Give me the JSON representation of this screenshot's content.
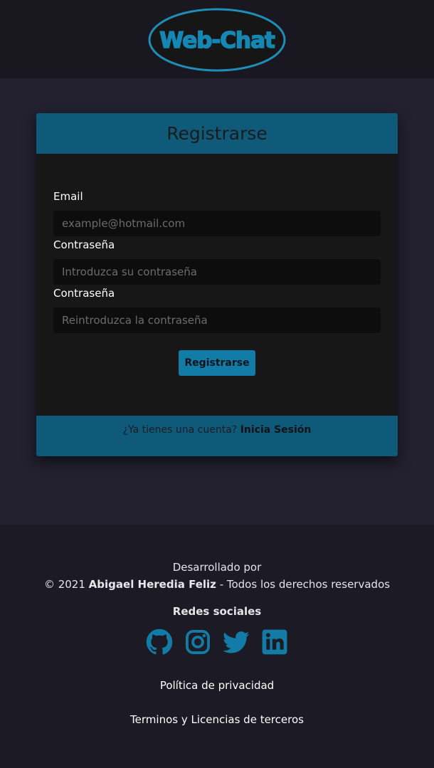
{
  "header": {
    "logo_text": "Web-Chat"
  },
  "colors": {
    "accent": "#0f5a79",
    "button": "#127ca6",
    "icon": "#127ca6",
    "background": "#23202f"
  },
  "register": {
    "title": "Registrarse",
    "email_label": "Email",
    "email_placeholder": "example@hotmail.com",
    "password_label": "Contraseña",
    "password_placeholder": "Introduzca su contraseña",
    "password2_label": "Contraseña",
    "password2_placeholder": "Reintroduzca la contraseña",
    "submit_label": "Registrarse",
    "footer_question": "¿Ya tienes una cuenta?",
    "login_link": "Inicia Sesión"
  },
  "footer": {
    "developed_by": "Desarrollado por",
    "copyright": "© 2021",
    "author": "Abigael Heredia Feliz",
    "rights": "- Todos los derechos reservados",
    "social_title": "Redes sociales",
    "social_icons": [
      "github-icon",
      "instagram-icon",
      "twitter-icon",
      "linkedin-icon"
    ],
    "privacy_link": "Política de privacidad",
    "terms_link": "Terminos y Licencias de terceros"
  }
}
